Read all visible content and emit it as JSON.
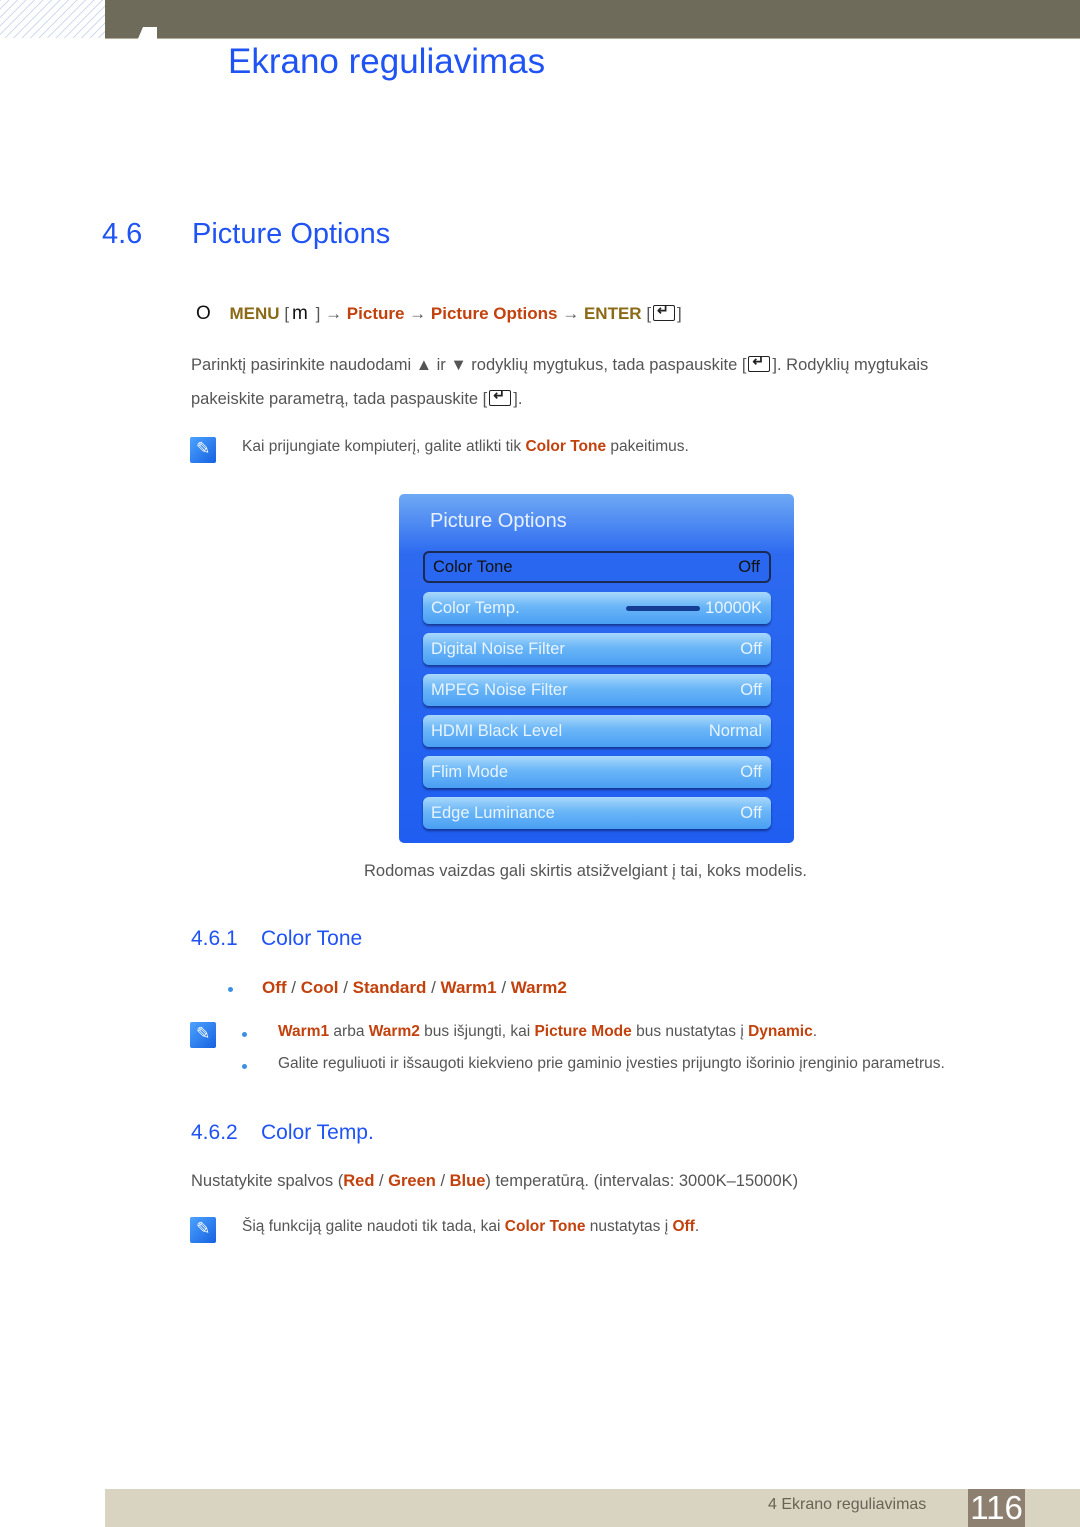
{
  "header": {
    "chapter_title": "Ekrano reguliavimas"
  },
  "section": {
    "number": "4.6",
    "title": "Picture Options"
  },
  "menu_path": {
    "lead_glyph": "O",
    "menu": "MENU",
    "menu_key": "m",
    "arrow": "→",
    "step1": "Picture",
    "step2": "Picture Options",
    "enter": "ENTER"
  },
  "intro": {
    "line1_a": "Parinktį pasirinkite naudodami ▲ ir ▼ rodyklių mygtukus, tada paspauskite [",
    "line1_b": "]. Rodyklių mygtukais",
    "line2_a": "pakeiskite parametrą, tada paspauskite [",
    "line2_b": "]."
  },
  "note1": {
    "before": "Kai prijungiate kompiuterį, galite atlikti tik ",
    "highlight": "Color Tone",
    "after": " pakeitimus."
  },
  "osd": {
    "title": "Picture Options",
    "rows": [
      {
        "label": "Color Tone",
        "value": "Off",
        "selected": true
      },
      {
        "label": "Color Temp.",
        "value": "10000K",
        "slider": true
      },
      {
        "label": "Digital Noise Filter",
        "value": "Off"
      },
      {
        "label": "MPEG Noise Filter",
        "value": "Off"
      },
      {
        "label": "HDMI Black Level",
        "value": "Normal"
      },
      {
        "label": "Flim Mode",
        "value": "Off"
      },
      {
        "label": "Edge Luminance",
        "value": "Off"
      }
    ]
  },
  "caption": "Rodomas vaizdas gali skirtis atsižvelgiant į tai, koks modelis.",
  "sub1": {
    "number": "4.6.1",
    "title": "Color Tone",
    "options": [
      "Off",
      "Cool",
      "Standard",
      "Warm1",
      "Warm2"
    ],
    "sep": " / ",
    "note_b1": {
      "h1": "Warm1",
      "t1": " arba ",
      "h2": "Warm2",
      "t2": " bus išjungti, kai ",
      "h3": "Picture Mode",
      "t3": " bus nustatytas į ",
      "h4": "Dynamic",
      "t4": "."
    },
    "note_b2": "Galite reguliuoti ir išsaugoti kiekvieno prie gaminio įvesties prijungto išorinio įrenginio parametrus."
  },
  "sub2": {
    "number": "4.6.2",
    "title": "Color Temp.",
    "para": {
      "t1": "Nustatykite spalvos (",
      "h1": "Red",
      "s1": " / ",
      "h2": "Green",
      "s2": " / ",
      "h3": "Blue",
      "t2": ") temperatūrą. (intervalas: 3000K–15000K)"
    },
    "note": {
      "t1": "Šią funkciją galite naudoti tik tada, kai ",
      "h1": "Color Tone",
      "t2": " nustatytas į ",
      "h2": "Off",
      "t3": "."
    }
  },
  "footer": {
    "chapter": "4 Ekrano reguliavimas",
    "page": "116"
  }
}
